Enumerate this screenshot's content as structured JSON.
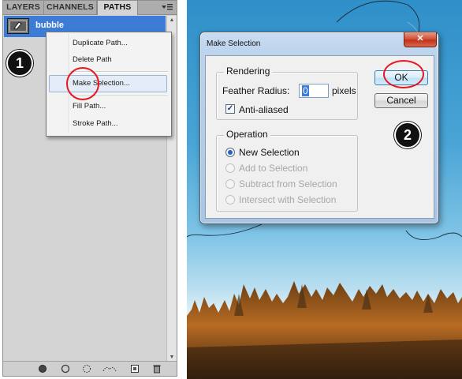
{
  "panel": {
    "tabs": [
      {
        "label": "LAYERS"
      },
      {
        "label": "CHANNELS"
      },
      {
        "label": "PATHS"
      }
    ],
    "menu_icon": "panel-menu-icon",
    "path_item": {
      "name": "bubble"
    },
    "footer_icons": [
      "fill-path-icon",
      "stroke-path-icon",
      "load-selection-icon",
      "make-work-path-icon",
      "new-path-icon",
      "trash-icon"
    ]
  },
  "context_menu": {
    "items": [
      "Duplicate Path...",
      "Delete Path",
      "Make Selection...",
      "Fill Path...",
      "Stroke Path..."
    ],
    "highlighted": "Make Selection..."
  },
  "steps": {
    "one": "1",
    "two": "2"
  },
  "dialog": {
    "title": "Make Selection",
    "close": "✕",
    "rendering": {
      "legend": "Rendering",
      "feather_label": "Feather Radius:",
      "feather_value": "0",
      "feather_unit": "pixels",
      "antialias_label": "Anti-aliased",
      "antialias_checked": true
    },
    "operation": {
      "legend": "Operation",
      "options": [
        {
          "label": "New Selection",
          "selected": true,
          "enabled": true
        },
        {
          "label": "Add to Selection",
          "selected": false,
          "enabled": false
        },
        {
          "label": "Subtract from Selection",
          "selected": false,
          "enabled": false
        },
        {
          "label": "Intersect with Selection",
          "selected": false,
          "enabled": false
        }
      ]
    },
    "ok_label": "OK",
    "cancel_label": "Cancel"
  },
  "colors": {
    "highlight_ring": "#e8161f",
    "selected_row": "#3d7cd6",
    "sky": "#4aa5d6"
  }
}
